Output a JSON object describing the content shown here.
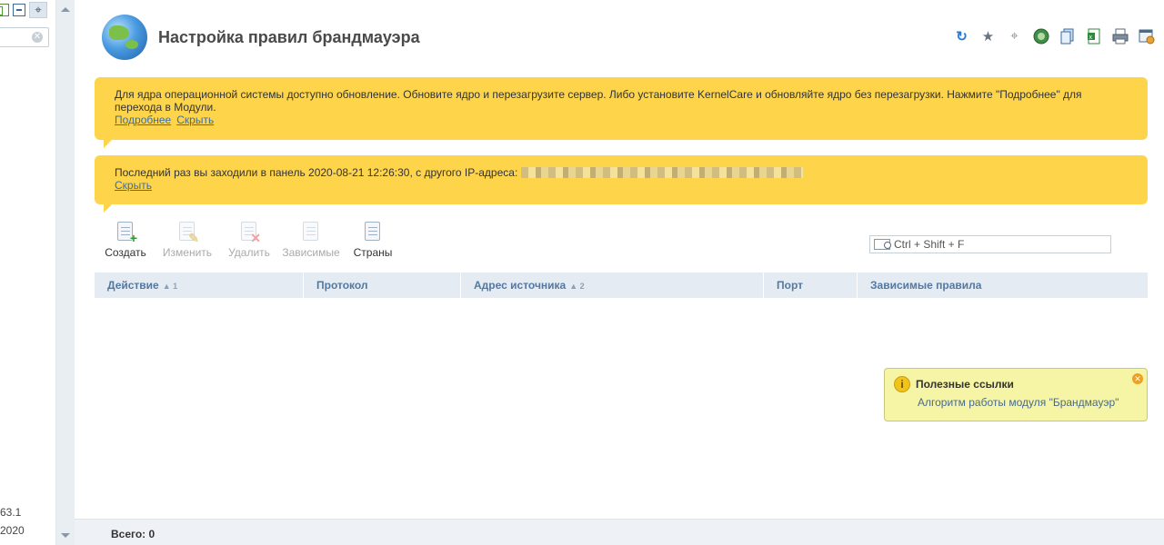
{
  "sidebar": {
    "search_placeholder": "",
    "version_line1": "63.1",
    "version_line2": "2020"
  },
  "header": {
    "title": "Настройка правил брандмауэра"
  },
  "toolbar_icons": [
    "refresh-icon",
    "star-icon",
    "pin-icon",
    "globe-icon",
    "copy-icon",
    "excel-icon",
    "print-icon",
    "settings-icon"
  ],
  "notice_kernel": {
    "text": "Для ядра операционной системы доступно обновление. Обновите ядро и перезагрузите сервер. Либо установите KernelCare и обновляйте ядро без перезагрузки. Нажмите \"Подробнее\" для перехода в Модули.",
    "details_link": "Подробнее",
    "hide_link": "Скрыть"
  },
  "notice_login": {
    "text": "Последний раз вы заходили в панель 2020-08-21 12:26:30, с другого IP-адреса:",
    "hide_link": "Скрыть"
  },
  "actions": {
    "create": "Создать",
    "edit": "Изменить",
    "delete": "Удалить",
    "dependent": "Зависимые",
    "countries": "Страны"
  },
  "filter": {
    "placeholder": "Ctrl + Shift + F"
  },
  "table": {
    "columns": [
      {
        "label": "Действие",
        "sort": "▲",
        "sort_index": "1"
      },
      {
        "label": "Протокол",
        "sort": "",
        "sort_index": ""
      },
      {
        "label": "Адрес источника",
        "sort": "▲",
        "sort_index": "2"
      },
      {
        "label": "Порт",
        "sort": "",
        "sort_index": ""
      },
      {
        "label": "Зависимые правила",
        "sort": "",
        "sort_index": ""
      }
    ],
    "rows": []
  },
  "help": {
    "title": "Полезные ссылки",
    "link": "Алгоритм работы модуля \"Брандмауэр\""
  },
  "footer": {
    "total": "Всего: 0"
  },
  "colors": {
    "notice_bg": "#fdd44a",
    "header_bg": "#e4ebf2",
    "link": "#3d6e9e",
    "help_bg": "#f6f5a5"
  }
}
